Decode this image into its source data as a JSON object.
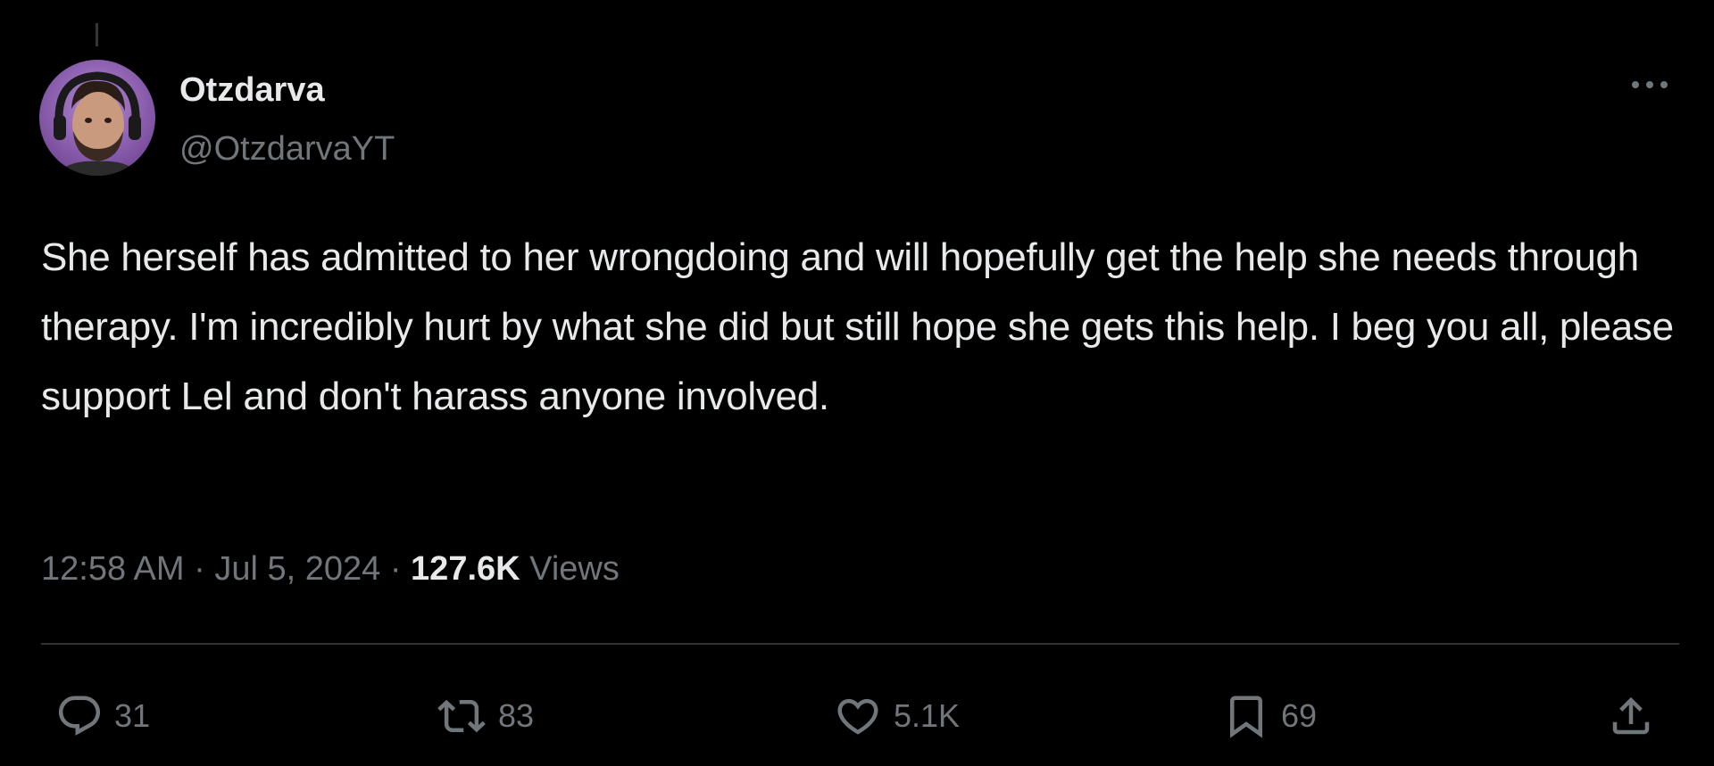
{
  "author": {
    "display_name": "Otzdarva",
    "handle": "@OtzdarvaYT",
    "avatar_icon": "avatar-photo"
  },
  "tweet": {
    "text": "She herself has admitted to her wrongdoing and will hopefully get the help she needs through therapy. I'm incredibly hurt by what she did but still hope she gets this help. I beg you all, please support Lel and don't harass anyone involved.",
    "time": "12:58 AM",
    "separator": "·",
    "date": "Jul 5, 2024",
    "views_count": "127.6K",
    "views_label": "Views"
  },
  "actions": {
    "reply": {
      "icon": "reply-icon",
      "count": "31"
    },
    "retweet": {
      "icon": "retweet-icon",
      "count": "83"
    },
    "like": {
      "icon": "heart-icon",
      "count": "5.1K"
    },
    "bookmark": {
      "icon": "bookmark-icon",
      "count": "69"
    },
    "share": {
      "icon": "share-icon"
    }
  },
  "colors": {
    "background": "#000000",
    "primary_text": "#e7e9ea",
    "secondary_text": "#71767b",
    "divider": "#2f3336"
  }
}
